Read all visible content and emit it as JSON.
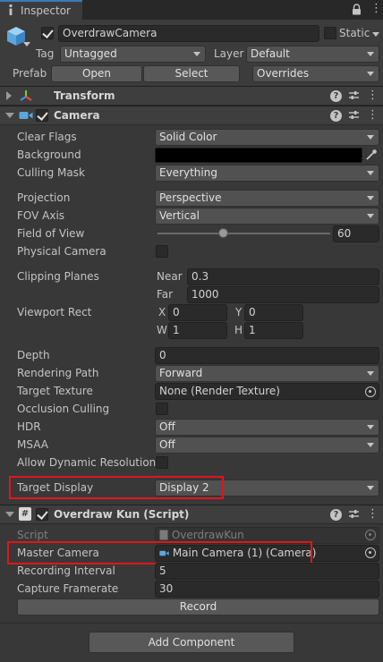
{
  "window": {
    "tab_title": "Inspector"
  },
  "gameobject": {
    "name": "OverdrawCamera",
    "static_label": "Static",
    "tag_label": "Tag",
    "tag_value": "Untagged",
    "layer_label": "Layer",
    "layer_value": "Default",
    "prefab_label": "Prefab",
    "open_label": "Open",
    "select_label": "Select",
    "overrides_label": "Overrides"
  },
  "transform": {
    "title": "Transform"
  },
  "camera": {
    "title": "Camera",
    "clear_flags": {
      "label": "Clear Flags",
      "value": "Solid Color"
    },
    "background": {
      "label": "Background",
      "color": "#000000"
    },
    "culling_mask": {
      "label": "Culling Mask",
      "value": "Everything"
    },
    "projection": {
      "label": "Projection",
      "value": "Perspective"
    },
    "fov_axis": {
      "label": "FOV Axis",
      "value": "Vertical"
    },
    "field_of_view": {
      "label": "Field of View",
      "value": "60",
      "slider_fraction": 0.38
    },
    "physical_camera": {
      "label": "Physical Camera"
    },
    "clipping_planes": {
      "label": "Clipping Planes",
      "near_label": "Near",
      "near_value": "0.3",
      "far_label": "Far",
      "far_value": "1000"
    },
    "viewport_rect": {
      "label": "Viewport Rect",
      "x_label": "X",
      "x_value": "0",
      "y_label": "Y",
      "y_value": "0",
      "w_label": "W",
      "w_value": "1",
      "h_label": "H",
      "h_value": "1"
    },
    "depth": {
      "label": "Depth",
      "value": "0"
    },
    "rendering_path": {
      "label": "Rendering Path",
      "value": "Forward"
    },
    "target_texture": {
      "label": "Target Texture",
      "value": "None (Render Texture)"
    },
    "occlusion_culling": {
      "label": "Occlusion Culling"
    },
    "hdr": {
      "label": "HDR",
      "value": "Off"
    },
    "msaa": {
      "label": "MSAA",
      "value": "Off"
    },
    "allow_dynamic_resolution": {
      "label": "Allow Dynamic Resolution"
    },
    "target_display": {
      "label": "Target Display",
      "value": "Display 2"
    }
  },
  "script": {
    "title": "Overdraw Kun (Script)",
    "script_label": "Script",
    "script_value": "OverdrawKun",
    "master_camera_label": "Master Camera",
    "master_camera_value": "Main Camera (1) (Camera)",
    "recording_interval_label": "Recording Interval",
    "recording_interval_value": "5",
    "capture_framerate_label": "Capture Framerate",
    "capture_framerate_value": "30",
    "record_label": "Record"
  },
  "add_component_label": "Add Component",
  "colors": {
    "highlight": "#e3141d",
    "accent": "#3a79bb"
  }
}
